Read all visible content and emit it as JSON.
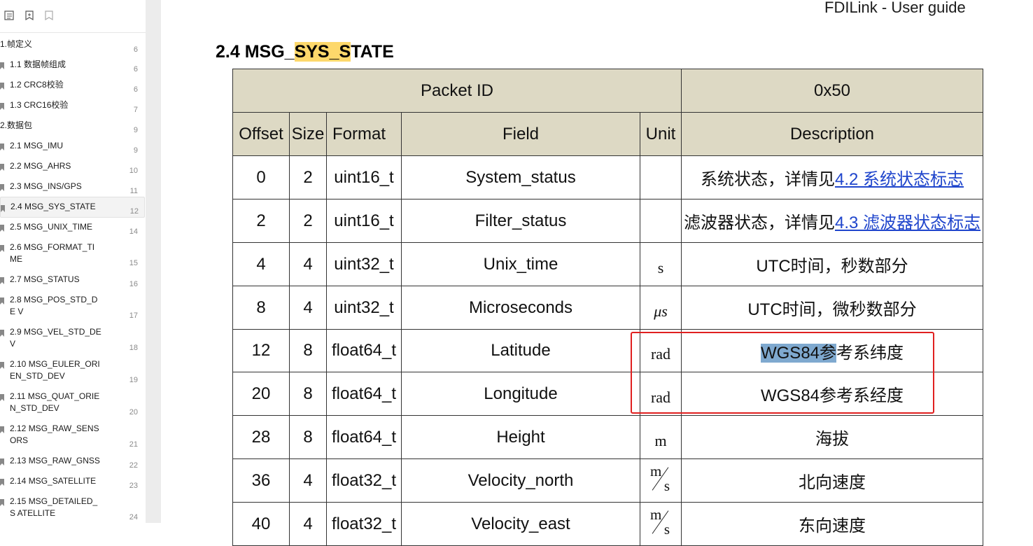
{
  "sidebar": {
    "toolbar": {
      "icons": [
        "outline-icon",
        "bookmark-add-icon",
        "bookmark-icon"
      ]
    },
    "items": [
      {
        "label": "1.帧定义",
        "page": "6",
        "level": 1
      },
      {
        "label": "1.1 数据帧组成",
        "page": "6",
        "level": 2
      },
      {
        "label": "1.2 CRC8校验",
        "page": "6",
        "level": 2
      },
      {
        "label": "1.3 CRC16校验",
        "page": "7",
        "level": 2
      },
      {
        "label": "2.数据包",
        "page": "9",
        "level": 1
      },
      {
        "label": "2.1 MSG_IMU",
        "page": "9",
        "level": 2
      },
      {
        "label": "2.2 MSG_AHRS",
        "page": "10",
        "level": 2
      },
      {
        "label": "2.3 MSG_INS/GPS",
        "page": "11",
        "level": 2
      },
      {
        "label": "2.4 MSG_SYS_STATE",
        "page": "12",
        "level": 2,
        "active": true
      },
      {
        "label": "2.5 MSG_UNIX_TIME",
        "page": "14",
        "level": 2
      },
      {
        "label": "2.6 MSG_FORMAT_TI ME",
        "page": "15",
        "level": 2
      },
      {
        "label": "2.7 MSG_STATUS",
        "page": "16",
        "level": 2
      },
      {
        "label": "2.8 MSG_POS_STD_DE V",
        "page": "17",
        "level": 2
      },
      {
        "label": "2.9 MSG_VEL_STD_DE V",
        "page": "18",
        "level": 2
      },
      {
        "label": "2.10 MSG_EULER_ORI EN_STD_DEV",
        "page": "19",
        "level": 2
      },
      {
        "label": "2.11 MSG_QUAT_ORIE N_STD_DEV",
        "page": "20",
        "level": 2
      },
      {
        "label": "2.12 MSG_RAW_SENS ORS",
        "page": "21",
        "level": 2
      },
      {
        "label": "2.13 MSG_RAW_GNSS",
        "page": "22",
        "level": 2
      },
      {
        "label": "2.14 MSG_SATELLITE",
        "page": "23",
        "level": 2
      },
      {
        "label": "2.15 MSG_DETAILED_S ATELLITE",
        "page": "24",
        "level": 2
      }
    ]
  },
  "doc": {
    "header_title": "FDILink - User guide",
    "heading": {
      "prefix": "2.4 MSG_",
      "highlight1": "SYS_",
      "highlight2": "S",
      "suffix": "TATE"
    },
    "table": {
      "packet_id_label": "Packet ID",
      "packet_id_value": "0x50",
      "columns": [
        "Offset",
        "Size",
        "Format",
        "Field",
        "Unit",
        "Description"
      ],
      "rows": [
        {
          "offset": "0",
          "size": "2",
          "format": "uint16_t",
          "field": "System_status",
          "unit": "",
          "desc": "系统状态，详情见",
          "link": "4.2  系统状态标志"
        },
        {
          "offset": "2",
          "size": "2",
          "format": "uint16_t",
          "field": "Filter_status",
          "unit": "",
          "desc": "滤波器状态，详情见",
          "link": "4.3  滤波器状态标志"
        },
        {
          "offset": "4",
          "size": "4",
          "format": "uint32_t",
          "field": "Unix_time",
          "unit": "s",
          "desc": "UTC时间，秒数部分"
        },
        {
          "offset": "8",
          "size": "4",
          "format": "uint32_t",
          "field": "Microseconds",
          "unit": "μs",
          "desc": "UTC时间，微秒数部分"
        },
        {
          "offset": "12",
          "size": "8",
          "format": "float64_t",
          "field": "Latitude",
          "unit": "rad",
          "desc_selected": "WGS84参",
          "desc": "考系纬度"
        },
        {
          "offset": "20",
          "size": "8",
          "format": "float64_t",
          "field": "Longitude",
          "unit": "rad",
          "desc": "WGS84参考系经度"
        },
        {
          "offset": "28",
          "size": "8",
          "format": "float64_t",
          "field": "Height",
          "unit": "m",
          "desc": "海拔"
        },
        {
          "offset": "36",
          "size": "4",
          "format": "float32_t",
          "field": "Velocity_north",
          "unit_num": "m",
          "unit_den": "s",
          "desc": "北向速度"
        },
        {
          "offset": "40",
          "size": "4",
          "format": "float32_t",
          "field": "Velocity_east",
          "unit_num": "m",
          "unit_den": "s",
          "desc": "东向速度"
        }
      ]
    }
  }
}
